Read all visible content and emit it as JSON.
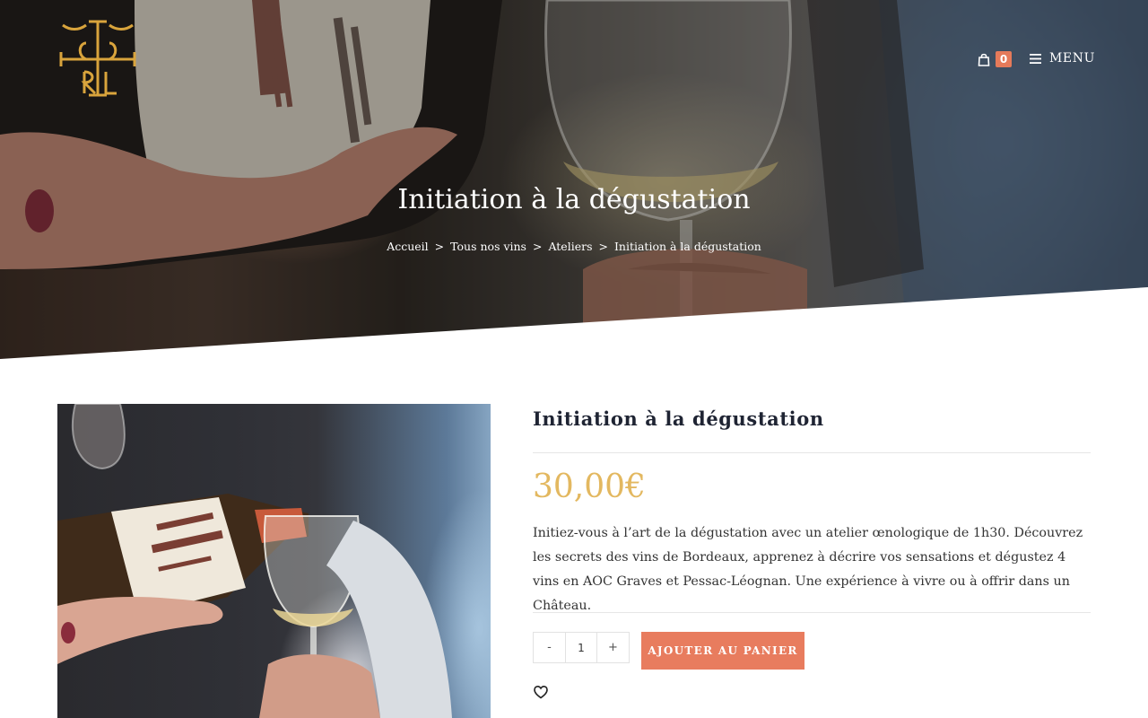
{
  "header": {
    "logo_icon": "chateau-monogram-logo",
    "cart_icon": "shopping-bag-icon",
    "cart_count": "0",
    "menu_icon": "hamburger-icon",
    "menu_label": "MENU"
  },
  "hero": {
    "title": "Initiation à la dégustation",
    "breadcrumb": [
      "Accueil",
      "Tous nos vins",
      "Ateliers",
      "Initiation à la dégustation"
    ],
    "breadcrumb_separator": ">"
  },
  "product": {
    "title": "Initiation à la dégustation",
    "price": "30,00€",
    "description": "Initiez-vous à l’art de la dégustation avec un atelier œnologique de 1h30. Découvrez les secrets des vins de Bordeaux, apprenez à décrire vos sensations et dégustez 4 vins en AOC Graves et Pessac-Léognan. Une expérience à vivre ou à offrir dans un Château.",
    "qty_minus": "-",
    "qty_value": "1",
    "qty_plus": "+",
    "add_to_cart_label": "AJOUTER AU PANIER",
    "wishlist_icon": "heart-icon"
  },
  "colors": {
    "accent": "#e87c5e",
    "price": "#e3b860",
    "logo_gold": "#d9a43c",
    "title": "#1f2433"
  }
}
